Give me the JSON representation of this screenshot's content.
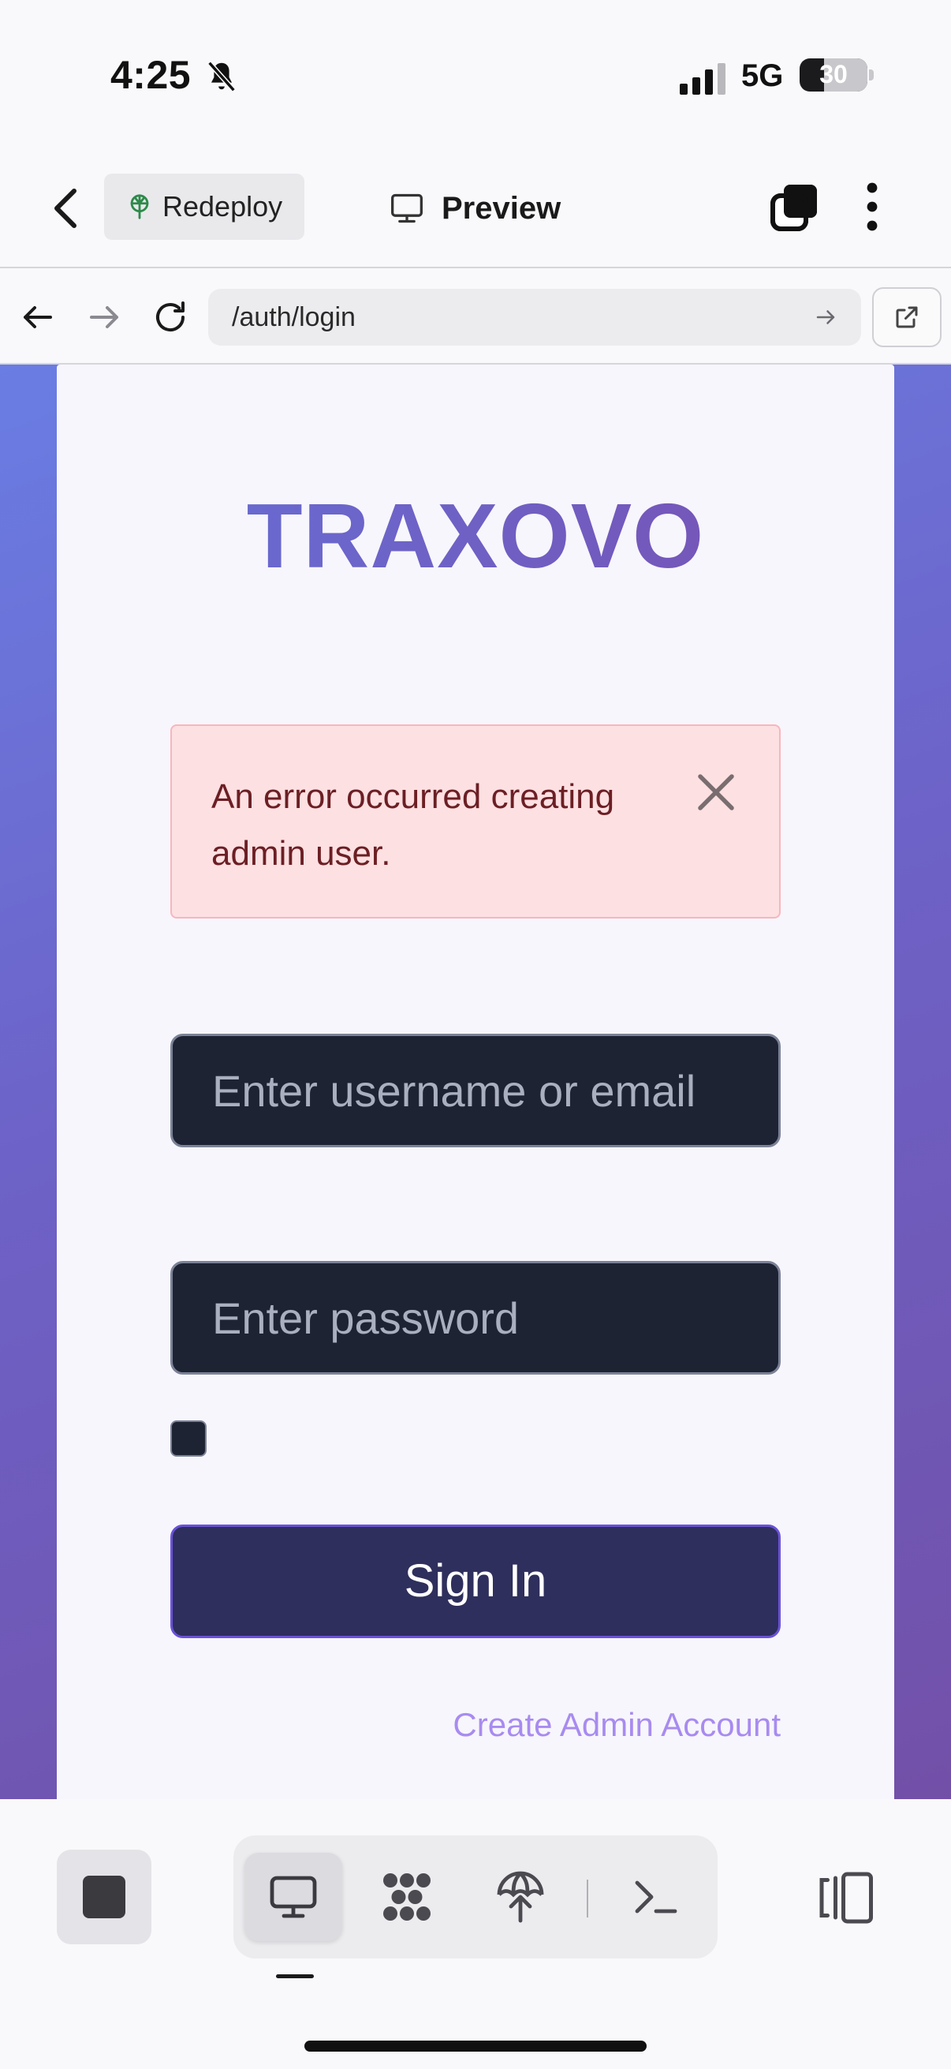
{
  "status_bar": {
    "time": "4:25",
    "network": "5G",
    "battery_level": "30"
  },
  "toolbar": {
    "redeploy_label": "Redeploy",
    "preview_label": "Preview"
  },
  "browser": {
    "url": "/auth/login"
  },
  "login": {
    "brand": "TRAXOVO",
    "error_message": "An error occurred creating admin user.",
    "username_placeholder": "Enter username or email",
    "password_placeholder": "Enter password",
    "signin_label": "Sign In",
    "create_admin_label": "Create Admin Account"
  },
  "colors": {
    "brand_gradient_start": "#6471d8",
    "brand_gradient_end": "#7a4fb0",
    "error_bg": "#fde0e2",
    "signin_bg": "#2e2f5c",
    "link": "#a88bf0"
  },
  "dock": {
    "tabs": [
      "monitor-icon",
      "nodes-icon",
      "deploy-icon",
      "terminal-icon"
    ],
    "active_tab": "monitor-icon"
  }
}
